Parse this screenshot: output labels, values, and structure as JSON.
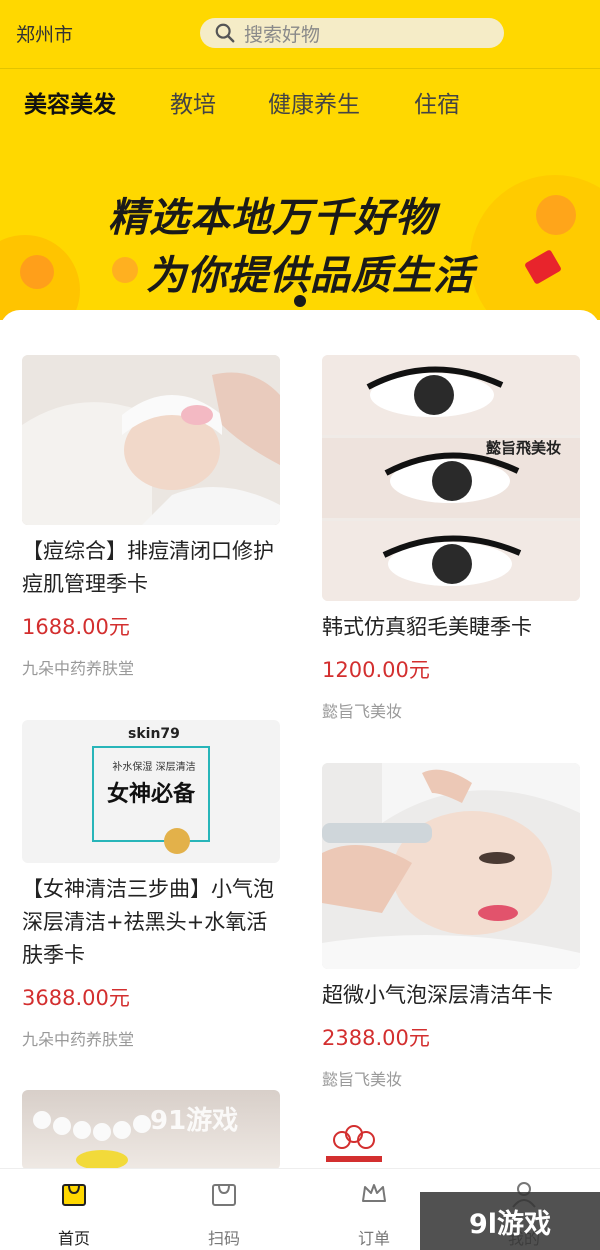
{
  "header": {
    "city": "郑州市",
    "search_placeholder": "搜索好物"
  },
  "categories": [
    "美容美发",
    "教培",
    "健康养生",
    "住宿"
  ],
  "banner": {
    "line1": "精选本地万千好物",
    "line2": "为你提供品质生活"
  },
  "products": [
    {
      "title": "【痘综合】排痘清闭口修护痘肌管理季卡",
      "price": "1688.00元",
      "shop": "九朵中药养肤堂"
    },
    {
      "title": "韩式仿真貂毛美睫季卡",
      "price": "1200.00元",
      "shop": "懿旨飞美妆",
      "image_text": "懿旨飛美妆"
    },
    {
      "title": "【女神清洁三步曲】小气泡深层清洁+祛黑头+水氧活肤季卡",
      "price": "3688.00元",
      "shop": "九朵中药养肤堂",
      "image_brand": "skin79",
      "image_sub": "补水保湿 深层清洁",
      "image_main": "女神必备"
    },
    {
      "title": "超微小气泡深层清洁年卡",
      "price": "2388.00元",
      "shop": "懿旨飞美妆"
    }
  ],
  "tabbar": [
    {
      "label": "首页",
      "icon": "shopping-bag-icon"
    },
    {
      "label": "扫码",
      "icon": "scan-bag-icon"
    },
    {
      "label": "订单",
      "icon": "crown-icon"
    },
    {
      "label": "我的",
      "icon": "user-icon"
    }
  ],
  "watermark": {
    "small": "91游戏",
    "corner": "9l游戏"
  },
  "colors": {
    "brand": "#ffd800",
    "price": "#d32f2f"
  }
}
